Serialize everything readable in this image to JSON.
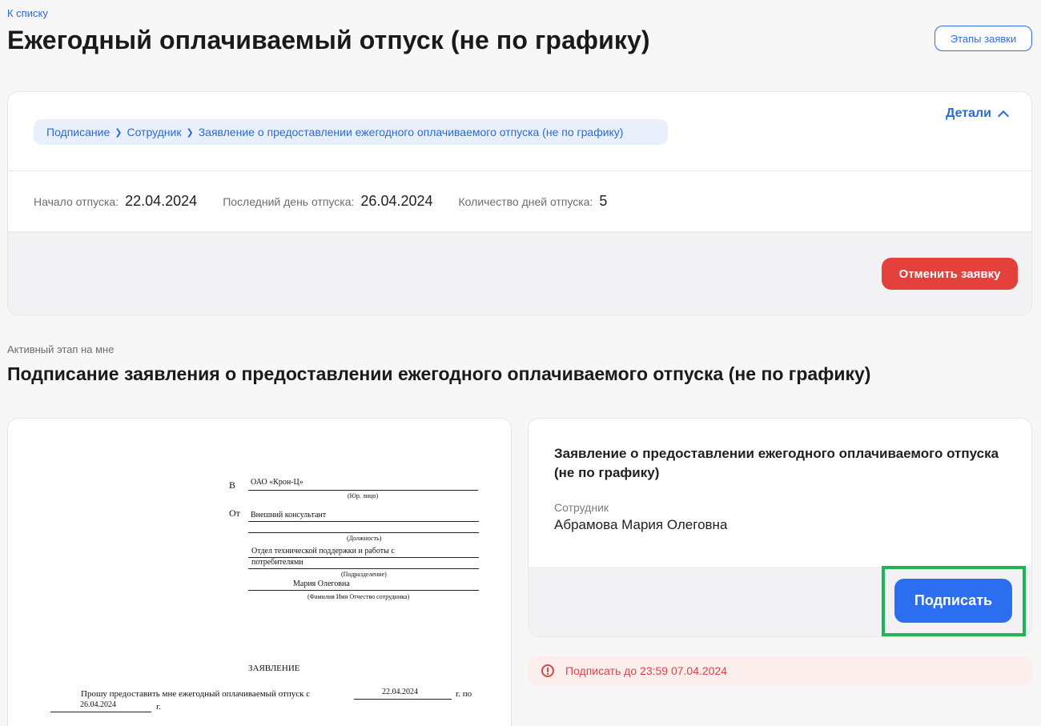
{
  "nav": {
    "back": "К списку"
  },
  "header": {
    "title": "Ежегодный оплачиваемый отпуск (не по графику)",
    "stages_button": "Этапы заявки"
  },
  "breadcrumb": [
    "Подписание",
    "Сотрудник",
    "Заявление о предоставлении ежегодного оплачиваемого отпуска (не по графику)"
  ],
  "details_label": "Детали",
  "fields": [
    {
      "label": "Начало отпуска:",
      "value": "22.04.2024"
    },
    {
      "label": "Последний день отпуска:",
      "value": "26.04.2024"
    },
    {
      "label": "Количество дней отпуска:",
      "value": "5"
    }
  ],
  "cancel_button": "Отменить заявку",
  "active_stage_label": "Активный этап на мне",
  "stage_title": "Подписание заявления о предоставлении ежегодного оплачиваемого отпуска (не по графику)",
  "document": {
    "to_label": "В",
    "to_value": "ОАО «Крон-Ц»",
    "to_caption": "(Юр. лицо)",
    "from_label": "От",
    "position_value": "Внешний консультант",
    "position_caption": "(Должность)",
    "department_line1": "Отдел технической поддержки и работы с",
    "department_line2": "потребителями",
    "department_caption": "(Подразделение)",
    "name_value": "Мария Олеговна",
    "name_caption": "(Фамилия Имя Отчество сотрудника)",
    "heading": "ЗАЯВЛЕНИЕ",
    "body_prefix": "Прошу предоставить мне ежегодный оплачиваемый отпуск с",
    "date_from": "22.04.2024",
    "to_word": "г. по",
    "date_to": "26.04.2024",
    "year_suffix": "г."
  },
  "sign_panel": {
    "doc_title": "Заявление о предоставлении ежегодного оплачиваемого отпуска (не по графику)",
    "employee_label": "Сотрудник",
    "employee_name": "Абрамова Мария Олеговна",
    "sign_button": "Подписать"
  },
  "deadline": "Подписать до 23:59 07.04.2024"
}
